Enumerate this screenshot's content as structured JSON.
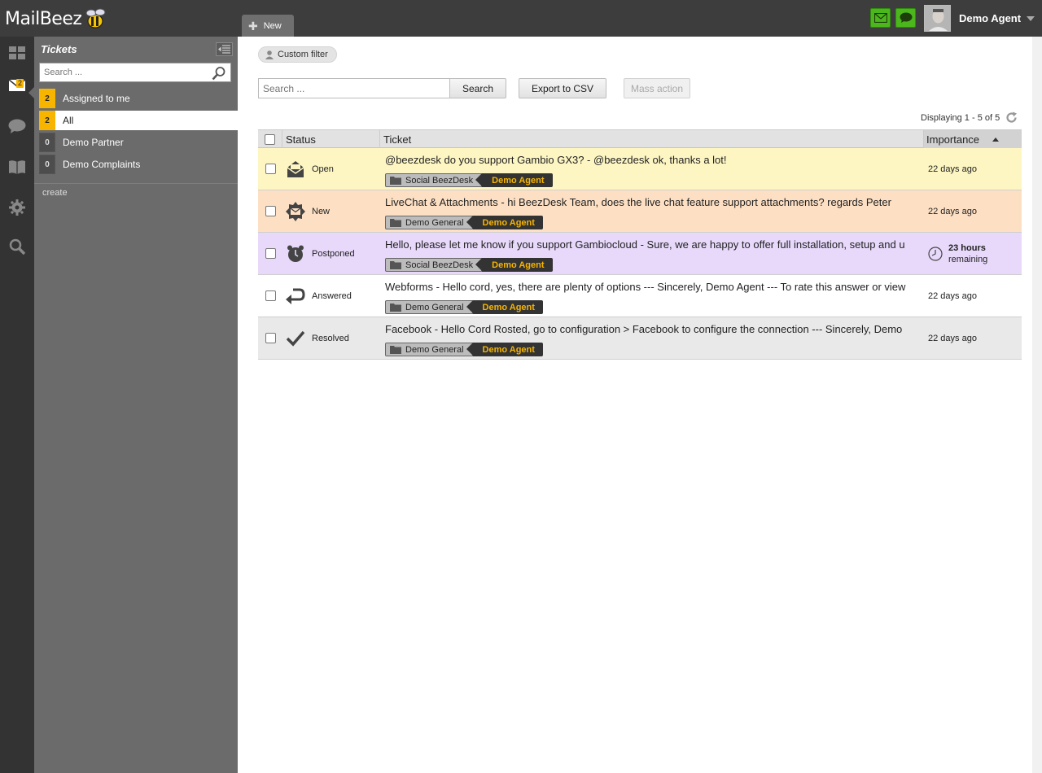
{
  "app": {
    "logo_text": "MailBeez",
    "new_tab_label": "New",
    "user_name": "Demo Agent"
  },
  "colors": {
    "topbar": "#3d3d3d",
    "panel": "#6b6b6b",
    "accent_yellow": "#f7b500",
    "green": "#4cb71d",
    "row_open": "#fdf6c3",
    "row_new": "#fde0c4",
    "row_postponed": "#e8d9fb",
    "row_resolved": "#e9e9e9"
  },
  "rail": {
    "items": [
      "dashboard-icon",
      "tickets-envelope-icon",
      "chat-bubble-icon",
      "knowledge-book-icon",
      "settings-gear-icon",
      "search-icon"
    ],
    "tickets_badge": "2"
  },
  "panel": {
    "title": "Tickets",
    "search_placeholder": "Search ...",
    "folders": [
      {
        "count": "2",
        "label": "Assigned to me"
      },
      {
        "count": "2",
        "label": "All"
      },
      {
        "count": "0",
        "label": "Demo Partner"
      },
      {
        "count": "0",
        "label": "Demo Complaints"
      }
    ],
    "create_label": "create"
  },
  "main": {
    "custom_filter_label": "Custom filter",
    "search_placeholder": "Search ...",
    "search_button": "Search",
    "export_button": "Export to CSV",
    "mass_action_button": "Mass action",
    "displaying_text": "Displaying 1 - 5 of 5",
    "columns": {
      "status": "Status",
      "ticket": "Ticket",
      "importance": "Importance"
    },
    "tickets": [
      {
        "status": "Open",
        "status_icon": "open-envelope-icon",
        "subject": "@beezdesk do you support Gambio GX3? - @beezdesk ok, thanks a lot!",
        "folder": "Social BeezDesk",
        "agent": "Demo Agent",
        "time": "22 days ago"
      },
      {
        "status": "New",
        "status_icon": "new-star-envelope-icon",
        "subject": "LiveChat & Attachments - hi BeezDesk Team, does the live chat feature support attachments? regards Peter",
        "folder": "Demo General",
        "agent": "Demo Agent",
        "time": "22 days ago"
      },
      {
        "status": "Postponed",
        "status_icon": "alarm-clock-icon",
        "subject": "Hello, please let me know if you support Gambiocloud - Sure, we are happy to offer full installation, setup and u",
        "folder": "Social BeezDesk",
        "agent": "Demo Agent",
        "remaining_amount": "23 hours",
        "remaining_label": "remaining"
      },
      {
        "status": "Answered",
        "status_icon": "reply-arrow-icon",
        "subject": "Webforms - Hello cord, yes, there are plenty of options --- Sincerely, Demo Agent --- To rate this answer or view",
        "folder": "Demo General",
        "agent": "Demo Agent",
        "time": "22 days ago"
      },
      {
        "status": "Resolved",
        "status_icon": "checkmark-icon",
        "subject": "Facebook - Hello Cord Rosted, go to configuration > Facebook to configure the connection --- Sincerely, Demo",
        "folder": "Demo General",
        "agent": "Demo Agent",
        "time": "22 days ago"
      }
    ]
  }
}
